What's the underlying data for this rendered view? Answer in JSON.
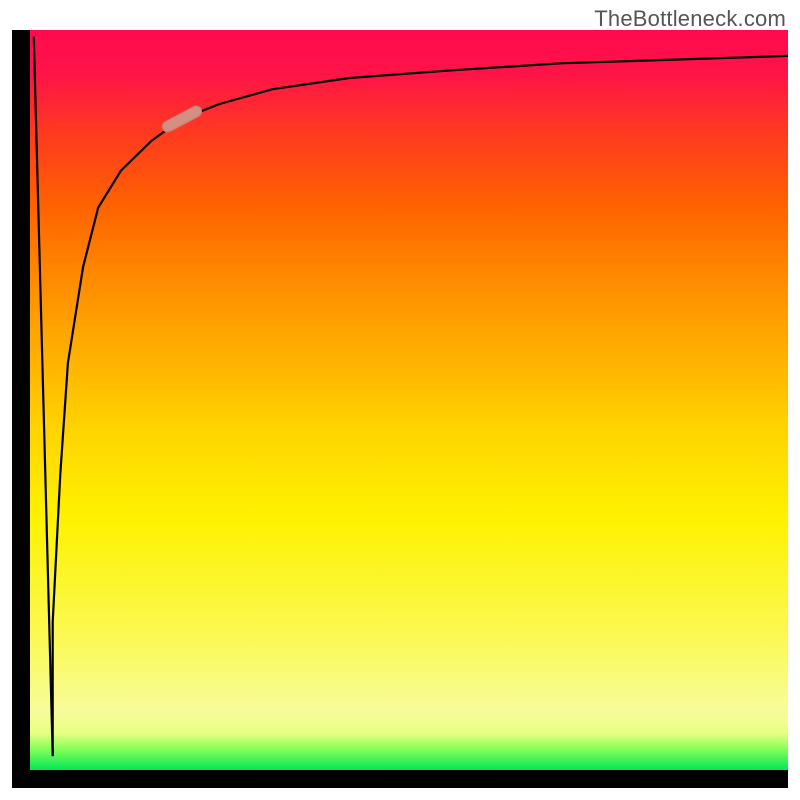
{
  "watermark": "TheBottleneck.com",
  "chart_data": {
    "type": "line",
    "title": "",
    "xlabel": "",
    "ylabel": "",
    "xlim": [
      0,
      100
    ],
    "ylim": [
      0,
      100
    ],
    "grid": false,
    "legend": false,
    "background_gradient": {
      "direction": "vertical",
      "stops": [
        {
          "pos": 0,
          "color": "#00e756"
        },
        {
          "pos": 5,
          "color": "#e8ff84"
        },
        {
          "pos": 34,
          "color": "#fef200"
        },
        {
          "pos": 56,
          "color": "#ffb000"
        },
        {
          "pos": 76,
          "color": "#ff6300"
        },
        {
          "pos": 94,
          "color": "#ff1447"
        },
        {
          "pos": 100,
          "color": "#ff0a4e"
        }
      ]
    },
    "series": [
      {
        "name": "bottleneck-curve",
        "comment": "Curve rises steeply from a cusp near the bottom-left and asymptotes near the top. Values are estimated from pixel positions on an unlabeled 0–100 range.",
        "x": [
          3,
          3,
          4,
          5,
          7,
          9,
          12,
          16,
          20,
          25,
          32,
          42,
          55,
          70,
          85,
          100
        ],
        "y": [
          2,
          20,
          40,
          55,
          68,
          76,
          81,
          85,
          88,
          90,
          92,
          93.5,
          94.5,
          95.5,
          96,
          96.5
        ]
      },
      {
        "name": "initial-drop",
        "comment": "Short near-vertical segment from top-left down to the cusp of the main curve.",
        "x": [
          0.5,
          3
        ],
        "y": [
          99,
          2
        ]
      }
    ],
    "marker": {
      "comment": "Pill-shaped highlight resting on the curve in the upper-left region.",
      "x": 20,
      "y": 88,
      "angle_deg": -28
    }
  },
  "colors": {
    "axis": "#000000",
    "curve": "#000000",
    "marker": "#d58e82",
    "watermark": "#555555"
  }
}
